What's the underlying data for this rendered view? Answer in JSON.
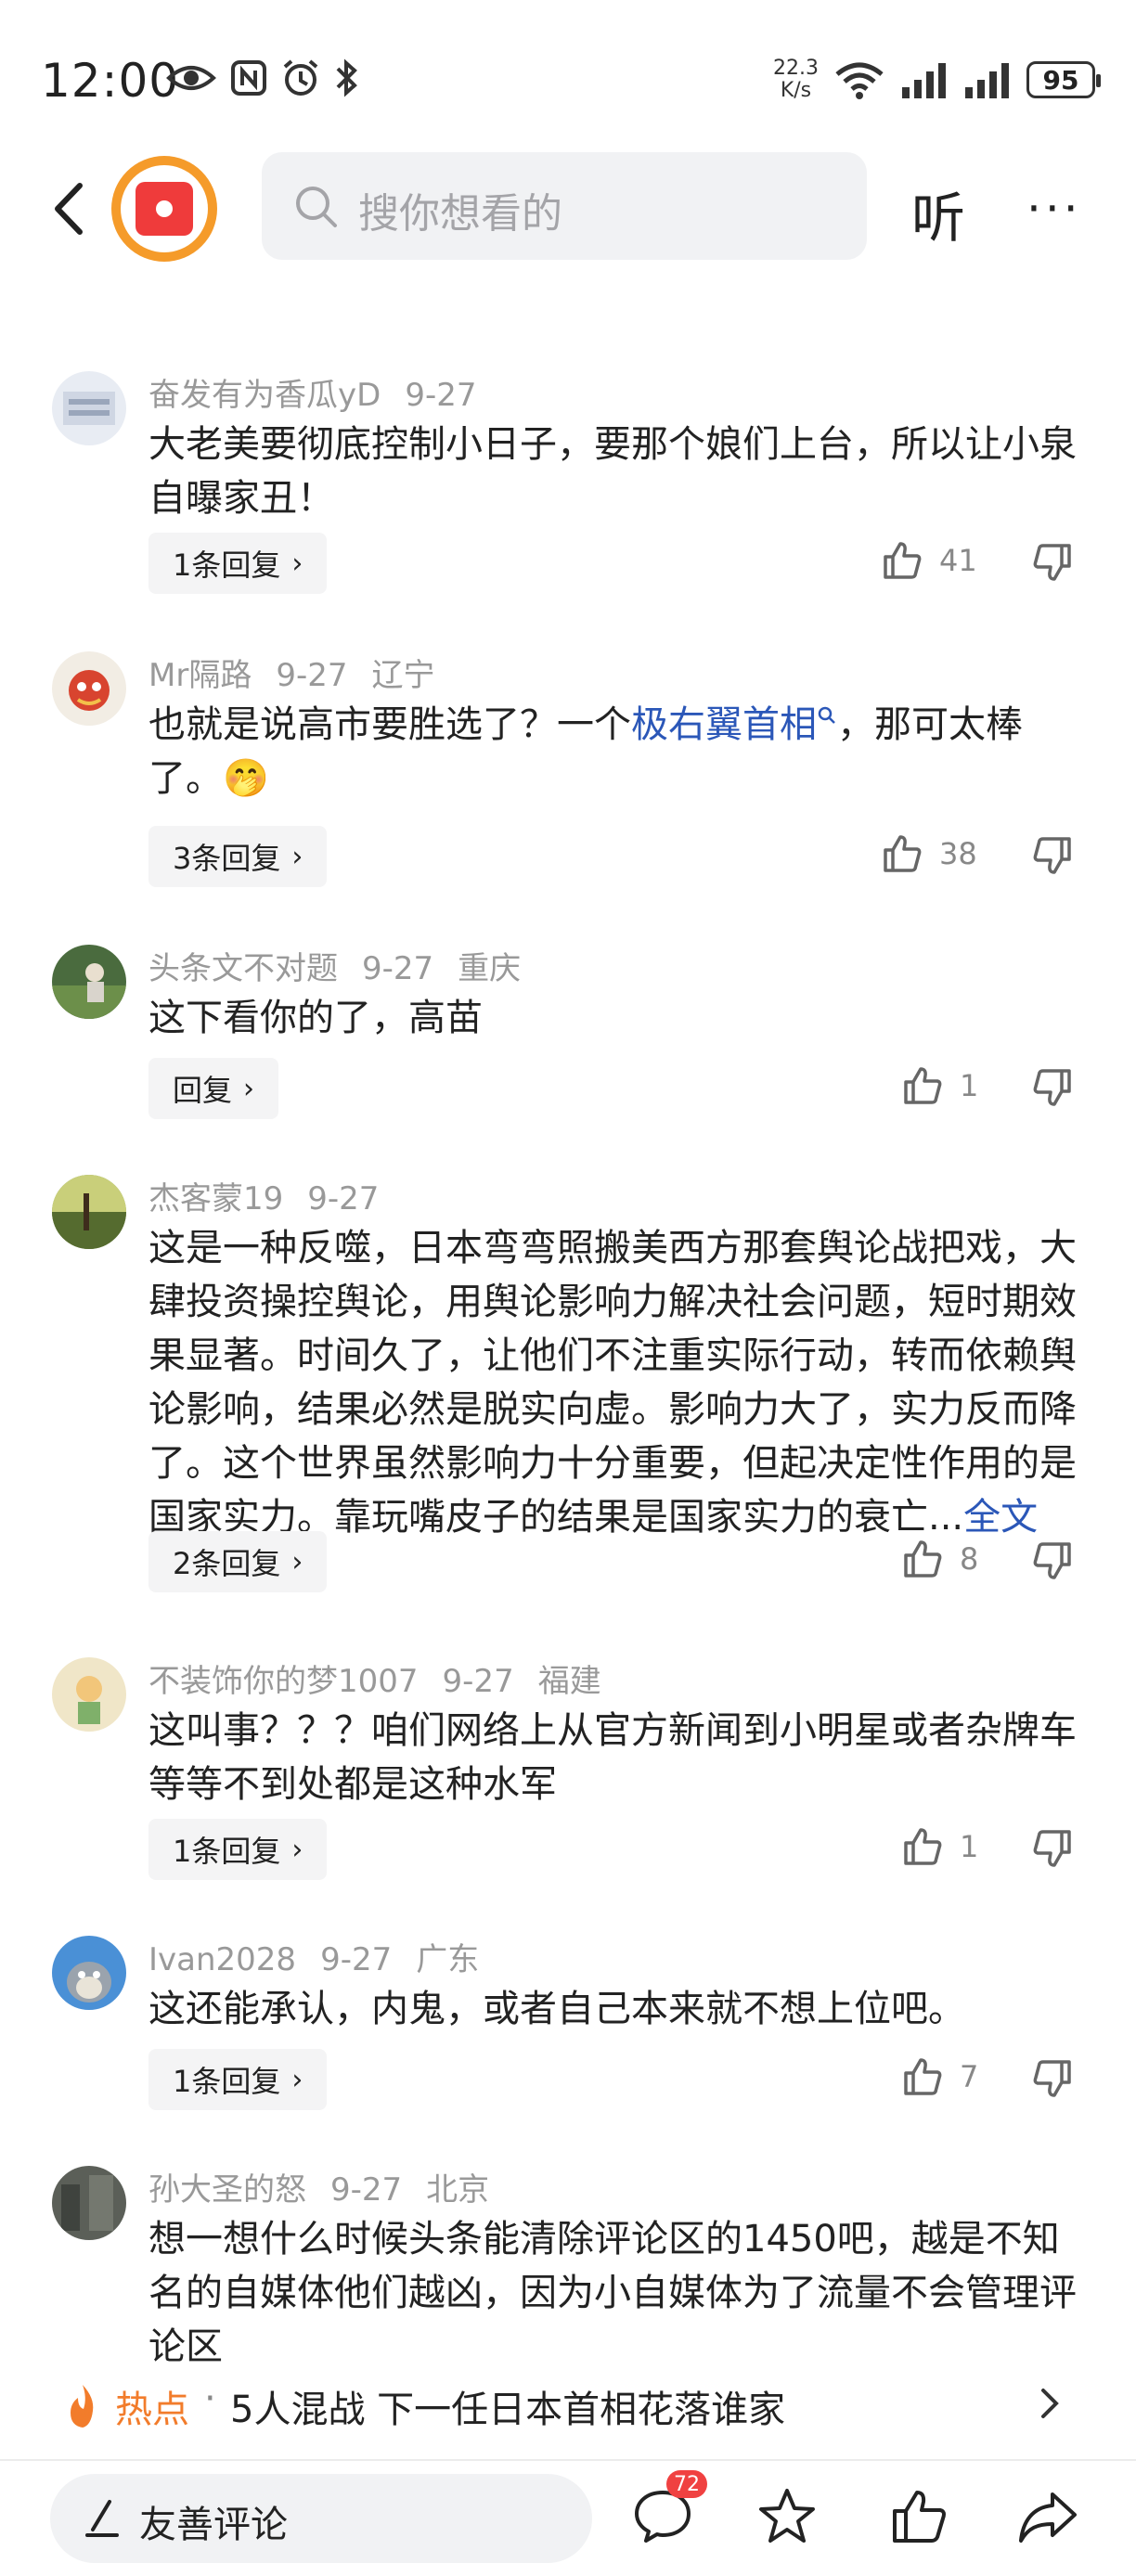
{
  "status_bar": {
    "time": "12:00",
    "net_speed_value": "22.3",
    "net_speed_unit": "K/s",
    "battery": "95"
  },
  "topnav": {
    "search_placeholder": "搜你想看的",
    "listen_label": "听",
    "more_label": "···"
  },
  "comments": [
    {
      "user": "奋发有为香瓜yD",
      "date": "9-27",
      "location": "",
      "text": "大老美要彻底控制小日子，要那个娘们上台，所以让小泉自曝家丑！",
      "reply_label": "1条回复",
      "likes": "41"
    },
    {
      "user": "Mr隔路",
      "date": "9-27",
      "location": "辽宁",
      "text_before": "也就是说高市要胜选了？一个",
      "link": "极右翼首相",
      "text_after": "，那可太棒了。🤭",
      "reply_label": "3条回复",
      "likes": "38"
    },
    {
      "user": "头条文不对题",
      "date": "9-27",
      "location": "重庆",
      "text": "这下看你的了，高苗",
      "reply_label": "回复",
      "likes": "1"
    },
    {
      "user": "杰客蒙19",
      "date": "9-27",
      "location": "",
      "text": "这是一种反噬，日本弯弯照搬美西方那套舆论战把戏，大肆投资操控舆论，用舆论影响力解决社会问题，短时期效果显著。时间久了，让他们不注重实际行动，转而依赖舆论影响，结果必然是脱实向虚。影响力大了，实力反而降了。这个世界虽然影响力十分重要，但起决定性作用的是国家实力。靠玩嘴皮子的结果是国家实力的衰亡...",
      "full_label": "全文",
      "reply_label": "2条回复",
      "likes": "8"
    },
    {
      "user": "不装饰你的梦1007",
      "date": "9-27",
      "location": "福建",
      "text": "这叫事？？？咱们网络上从官方新闻到小明星或者杂牌车等等不到处都是这种水军",
      "reply_label": "1条回复",
      "likes": "1"
    },
    {
      "user": "Ivan2028",
      "date": "9-27",
      "location": "广东",
      "text": "这还能承认，内鬼，或者自己本来就不想上位吧。",
      "reply_label": "1条回复",
      "likes": "7"
    },
    {
      "user": "孙大圣的怒",
      "date": "9-27",
      "location": "北京",
      "text": "想一想什么时候头条能清除评论区的1450吧，越是不知名的自媒体他们越凶，因为小自媒体为了流量不会管理评论区"
    }
  ],
  "hot": {
    "label": "热点",
    "dot": "·",
    "text": "5人混战 下一任日本首相花落谁家"
  },
  "bottom_bar": {
    "comment_placeholder": "友善评论",
    "comment_count": "72"
  },
  "colors": {
    "accent_link": "#2b57b8",
    "hot": "#f27c2b",
    "badge": "#f04141",
    "logo_ring": "#f59b2a",
    "logo_core": "#ef3b3b"
  }
}
